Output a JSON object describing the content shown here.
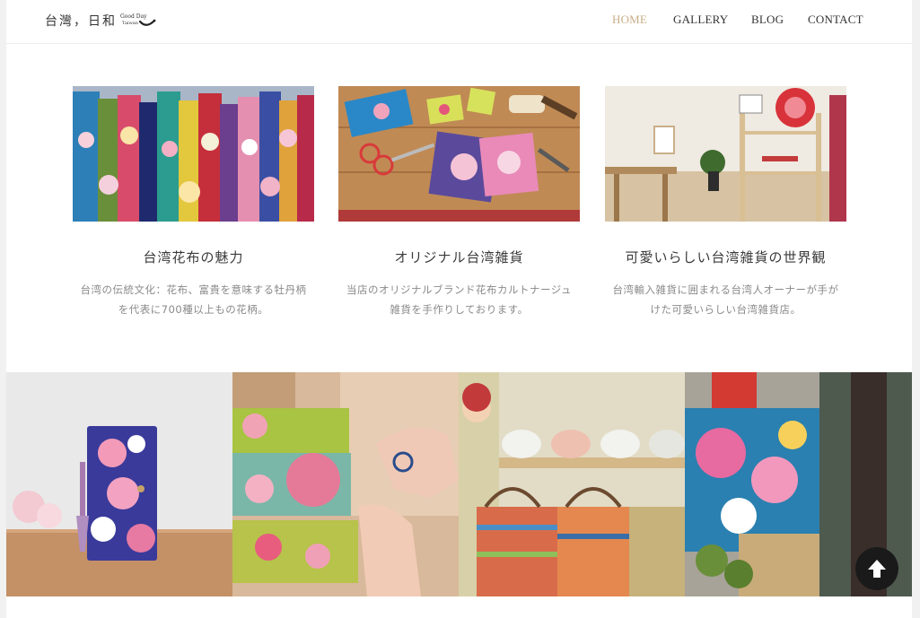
{
  "header": {
    "logo": {
      "text": "台灣，日和",
      "mark_text": "Good Day Taiwan"
    },
    "nav": [
      {
        "label": "HOME",
        "active": true
      },
      {
        "label": "GALLERY",
        "active": false
      },
      {
        "label": "BLOG",
        "active": false
      },
      {
        "label": "CONTACT",
        "active": false
      }
    ]
  },
  "features": [
    {
      "title": "台湾花布の魅力",
      "desc_line1": "台湾の伝統文化：花布、富貴を意味する牡丹柄",
      "desc_line2": "を代表に700種以上もの花柄。"
    },
    {
      "title": "オリジナル台湾雑貨",
      "desc_line1": "当店のオリジナルブランド花布カルトナージュ",
      "desc_line2": "雑貨を手作りしております。"
    },
    {
      "title": "可愛いらしい台湾雑貨の世界観",
      "desc_line1": "台湾輸入雑貨に囲まれる台湾人オーナーが手が",
      "desc_line2": "けた可愛いらしい台湾雑貨店。"
    }
  ],
  "gallery": [
    {
      "icon": "phone-case-photo"
    },
    {
      "icon": "handmade-notebooks-photo"
    },
    {
      "icon": "shop-shelf-bags-photo"
    },
    {
      "icon": "floral-fabric-shop-photo"
    }
  ],
  "back_to_top": {
    "icon": "arrow-up-icon"
  },
  "colors": {
    "accent": "#c8ae85",
    "text": "#333333",
    "muted": "#8a8a8a",
    "button": "#1a1a1a"
  }
}
